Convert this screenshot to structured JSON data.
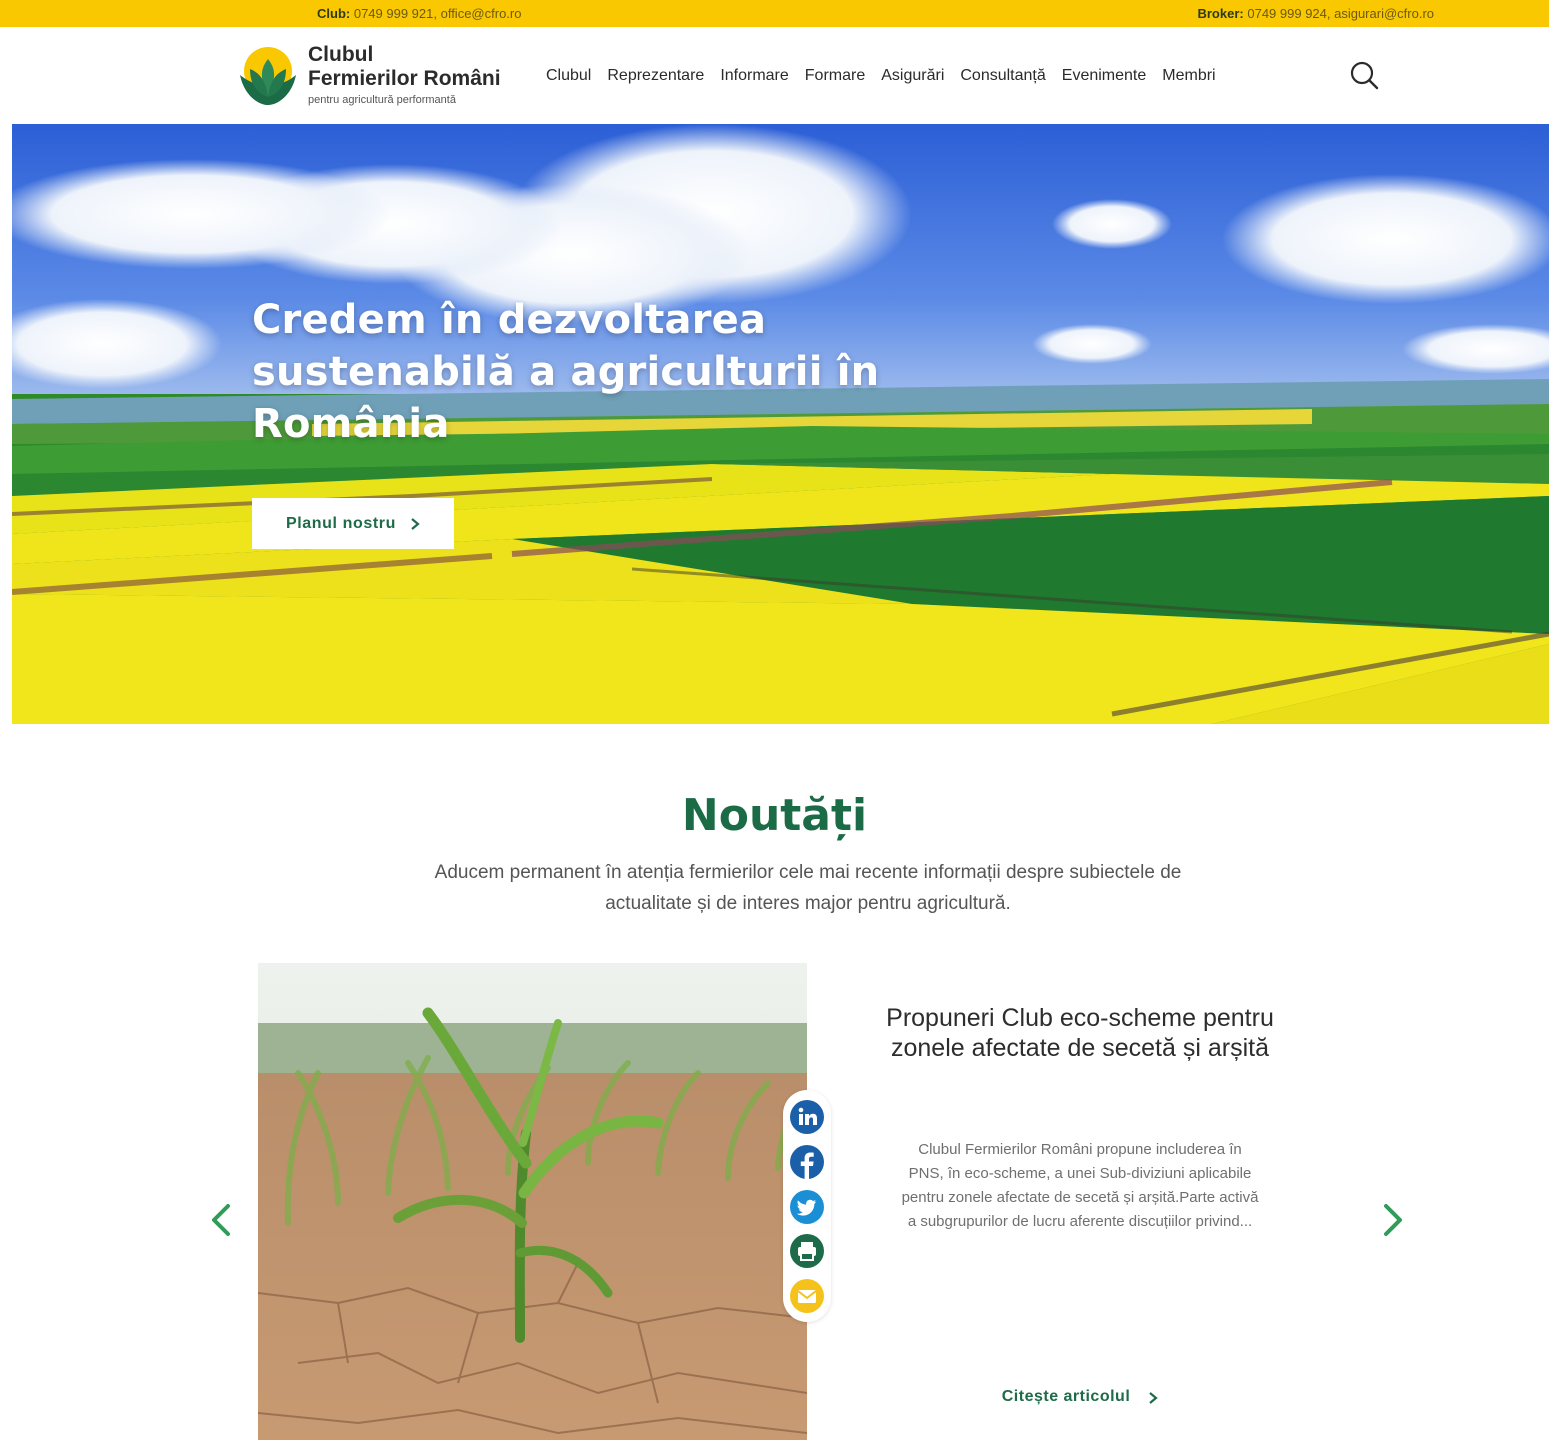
{
  "topbar": {
    "club_label": "Club:",
    "club_contact": "0749 999 921, office@cfro.ro",
    "broker_label": "Broker:",
    "broker_contact": "0749 999 924, asigurari@cfro.ro"
  },
  "logo": {
    "line1": "Clubul",
    "line2": "Fermierilor Români",
    "tagline": "pentru agricultură performantă"
  },
  "nav": {
    "items": [
      "Clubul",
      "Reprezentare",
      "Informare",
      "Formare",
      "Asigurări",
      "Consultanță",
      "Evenimente",
      "Membri"
    ]
  },
  "hero": {
    "title": "Credem în dezvoltarea sustenabilă a agriculturii în România",
    "button_label": "Planul nostru"
  },
  "news": {
    "title": "Noutăți",
    "subtitle": "Aducem permanent în atenția fermierilor cele mai recente informații despre subiectele de actualitate și de interes major pentru agricultură.",
    "article": {
      "title": "Propuneri Club eco-scheme pentru zonele afectate de secetă și arșită",
      "excerpt": "Clubul Fermierilor Români propune includerea în PNS, în eco-scheme, a unei Sub-diviziuni aplicabile pentru zonele afectate de secetă și arșită.Parte activă a subgrupurilor de lucru aferente discuțiilor privind...",
      "link_label": "Citește articolul"
    },
    "share_icons": [
      "linkedin-icon",
      "facebook-icon",
      "twitter-icon",
      "print-icon",
      "email-icon"
    ]
  },
  "colors": {
    "topbar": "#f9c800",
    "brand_green": "#1b6b47",
    "share_blue": "#1b5fa8",
    "share_green": "#1d6b48",
    "share_yellow": "#f5c21b"
  }
}
